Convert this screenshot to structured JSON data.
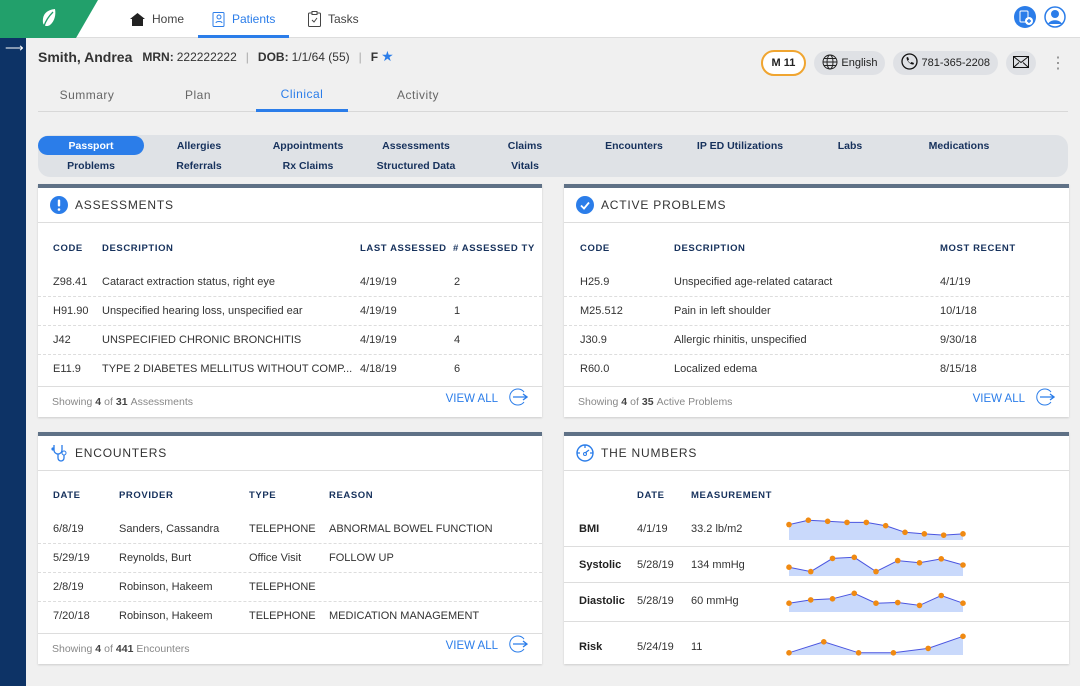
{
  "topnav": {
    "items": [
      {
        "label": "Home",
        "icon": "home-icon"
      },
      {
        "label": "Patients",
        "icon": "patients-icon",
        "active": true
      },
      {
        "label": "Tasks",
        "icon": "clipboard-icon"
      }
    ]
  },
  "patient": {
    "name": "Smith, Andrea",
    "mrn_label": "MRN:",
    "mrn": "222222222",
    "dob_label": "DOB:",
    "dob": "1/1/64 (55)",
    "sex": "F",
    "badge": "M 11",
    "language": "English",
    "phone": "781-365-2208"
  },
  "tabs": [
    {
      "label": "Summary"
    },
    {
      "label": "Plan"
    },
    {
      "label": "Clinical",
      "active": true
    },
    {
      "label": "Activity"
    }
  ],
  "pills": {
    "row1": [
      "Passport",
      "Allergies",
      "Appointments",
      "Assessments",
      "Claims",
      "Encounters",
      "IP ED Utilizations",
      "Labs",
      "Medications"
    ],
    "row2": [
      "Problems",
      "Referrals",
      "Rx Claims",
      "Structured Data",
      "Vitals"
    ],
    "active": "Passport"
  },
  "assessments": {
    "title": "ASSESSMENTS",
    "columns": [
      "CODE",
      "DESCRIPTION",
      "LAST ASSESSED",
      "# ASSESSED TY"
    ],
    "rows": [
      [
        "Z98.41",
        "Cataract extraction status, right eye",
        "4/19/19",
        "2"
      ],
      [
        "H91.90",
        "Unspecified hearing loss, unspecified ear",
        "4/19/19",
        "1"
      ],
      [
        "J42",
        "UNSPECIFIED CHRONIC BRONCHITIS",
        "4/19/19",
        "4"
      ],
      [
        "E11.9",
        "TYPE 2 DIABETES MELLITUS WITHOUT COMP...",
        "4/18/19",
        "6"
      ]
    ],
    "footer": {
      "prefix": "Showing",
      "shown": "4",
      "of": "of",
      "total": "31",
      "suffix": "Assessments"
    },
    "view_all": "VIEW ALL"
  },
  "problems": {
    "title": "ACTIVE PROBLEMS",
    "columns": [
      "CODE",
      "DESCRIPTION",
      "MOST RECENT"
    ],
    "rows": [
      [
        "H25.9",
        "Unspecified age-related cataract",
        "4/1/19"
      ],
      [
        "M25.512",
        "Pain in left shoulder",
        "10/1/18"
      ],
      [
        "J30.9",
        "Allergic rhinitis, unspecified",
        "9/30/18"
      ],
      [
        "R60.0",
        "Localized edema",
        "8/15/18"
      ]
    ],
    "footer": {
      "prefix": "Showing",
      "shown": "4",
      "of": "of",
      "total": "35",
      "suffix": "Active Problems"
    },
    "view_all": "VIEW ALL"
  },
  "encounters": {
    "title": "ENCOUNTERS",
    "columns": [
      "DATE",
      "PROVIDER",
      "TYPE",
      "REASON"
    ],
    "rows": [
      [
        "6/8/19",
        "Sanders, Cassandra",
        "TELEPHONE",
        "ABNORMAL BOWEL FUNCTION"
      ],
      [
        "5/29/19",
        "Reynolds, Burt",
        "Office Visit",
        "FOLLOW UP"
      ],
      [
        "2/8/19",
        "Robinson, Hakeem",
        "TELEPHONE",
        ""
      ],
      [
        "7/20/18",
        "Robinson, Hakeem",
        "TELEPHONE",
        "MEDICATION MANAGEMENT"
      ]
    ],
    "footer": {
      "prefix": "Showing",
      "shown": "4",
      "of": "of",
      "total": "441",
      "suffix": "Encounters"
    },
    "view_all": "VIEW ALL"
  },
  "numbers": {
    "title": "THE NUMBERS",
    "columns": [
      "DATE",
      "MEASUREMENT"
    ],
    "rows": [
      {
        "label": "BMI",
        "date": "4/1/19",
        "value": "33.2 lb/m2",
        "trend": [
          7,
          9,
          8.5,
          8,
          8,
          6.5,
          3.5,
          2.8,
          2.2,
          2.8
        ]
      },
      {
        "label": "Systolic",
        "date": "5/28/19",
        "value": "134 mmHg",
        "trend": [
          4,
          2,
          8,
          8.5,
          2,
          7,
          6,
          7.8,
          5
        ]
      },
      {
        "label": "Diastolic",
        "date": "5/28/19",
        "value": "60 mmHg",
        "trend": [
          4,
          5.5,
          6,
          8.5,
          4,
          4.3,
          3,
          7.5,
          4
        ]
      },
      {
        "label": "Risk",
        "date": "5/24/19",
        "value": "11",
        "trend": [
          1,
          6,
          1,
          1,
          3,
          8.5
        ]
      }
    ]
  },
  "colors": {
    "accent": "#2b7de9",
    "brand": "#22a06b",
    "sidebar": "#0d3366",
    "spark_line": "#4a55e0",
    "spark_fill": "#c9d9fb",
    "spark_dot": "#f08a12"
  }
}
